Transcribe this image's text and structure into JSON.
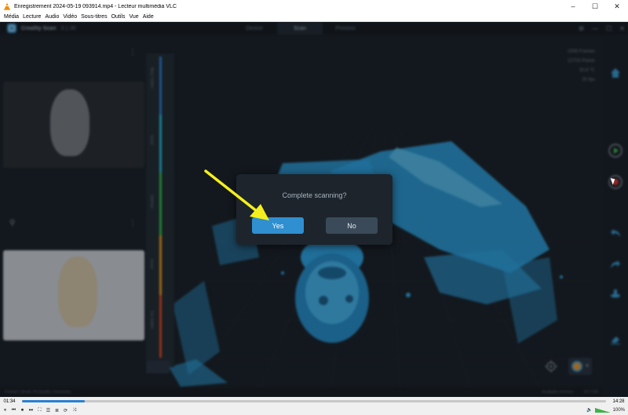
{
  "window": {
    "title": "Enregistrement 2024-05-19 093914.mp4 - Lecteur multimédia VLC",
    "minimize": "–",
    "maximize": "☐",
    "close": "✕"
  },
  "menu": [
    "Média",
    "Lecture",
    "Audio",
    "Vidéo",
    "Sous-titres",
    "Outils",
    "Vue",
    "Aide"
  ],
  "app": {
    "name": "Creality Scan",
    "version": "3.1.30",
    "tabs": [
      {
        "label": "Device",
        "active": false
      },
      {
        "label": "Scan",
        "active": true
      },
      {
        "label": "Process",
        "active": false
      }
    ],
    "stats": [
      "1506 Frames",
      "22703 Points",
      "30.6 ℃",
      "30 fps"
    ],
    "depth_labels": [
      "Near Outlier",
      "Good",
      "Optimal",
      "Good",
      "Far Outlier"
    ],
    "status": "Portrait | Small | Hi Quality | Geometry",
    "status_right": "Available memory",
    "memory": "20.2 GB"
  },
  "dialog": {
    "message": "Complete scanning?",
    "yes_label": "Yes",
    "no_label": "No"
  },
  "player": {
    "elapsed": "01:34",
    "total": "14:28",
    "progress": 0.108,
    "volume": "100%"
  },
  "colors": {
    "accent": "#2f8fd0",
    "scan_cloud": "#2ea6e6",
    "arrow": "#f5ef1e",
    "vlc_orange": "#f48b00"
  }
}
